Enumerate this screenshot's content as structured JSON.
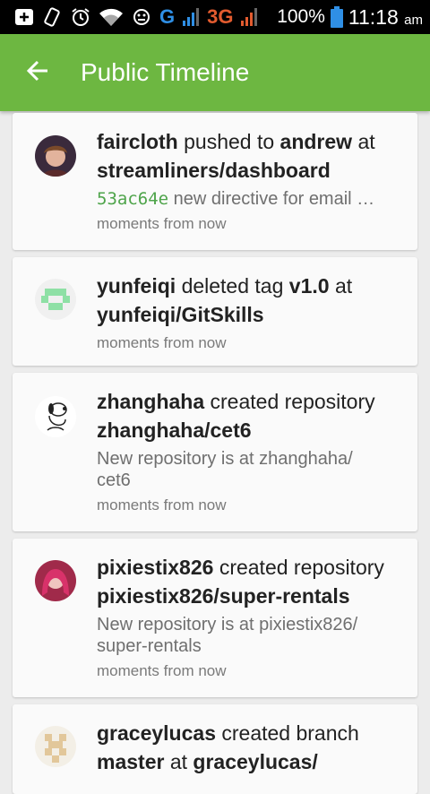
{
  "status_bar": {
    "signal_g": "G",
    "signal_3g": "3G",
    "battery_percent": "100%",
    "time": "11:18",
    "ampm": "am"
  },
  "app_bar": {
    "title": "Public Timeline"
  },
  "feed": [
    {
      "user": "faircloth",
      "action": "pushed to",
      "target": "andrew",
      "connector": "at",
      "repo": "streamliners/dashboard",
      "sha": "53ac64e",
      "description": "new directive for email …",
      "time": "moments from now"
    },
    {
      "user": "yunfeiqi",
      "action": "deleted tag",
      "target": "v1.0",
      "connector": "at",
      "repo": "yunfeiqi/GitSkills",
      "time": "moments from now"
    },
    {
      "user": "zhanghaha",
      "action": "created repository",
      "repo": "zhanghaha/cet6",
      "description": "New repository is at zhanghaha/ cet6",
      "time": "moments from now"
    },
    {
      "user": "pixiestix826",
      "action": "created repository",
      "repo": "pixiestix826/super-rentals",
      "description": "New repository is at pixiestix826/ super-rentals",
      "time": "moments from now"
    },
    {
      "user": "graceylucas",
      "action": "created branch",
      "target": "master",
      "connector": "at",
      "repo": "graceylucas/"
    }
  ]
}
